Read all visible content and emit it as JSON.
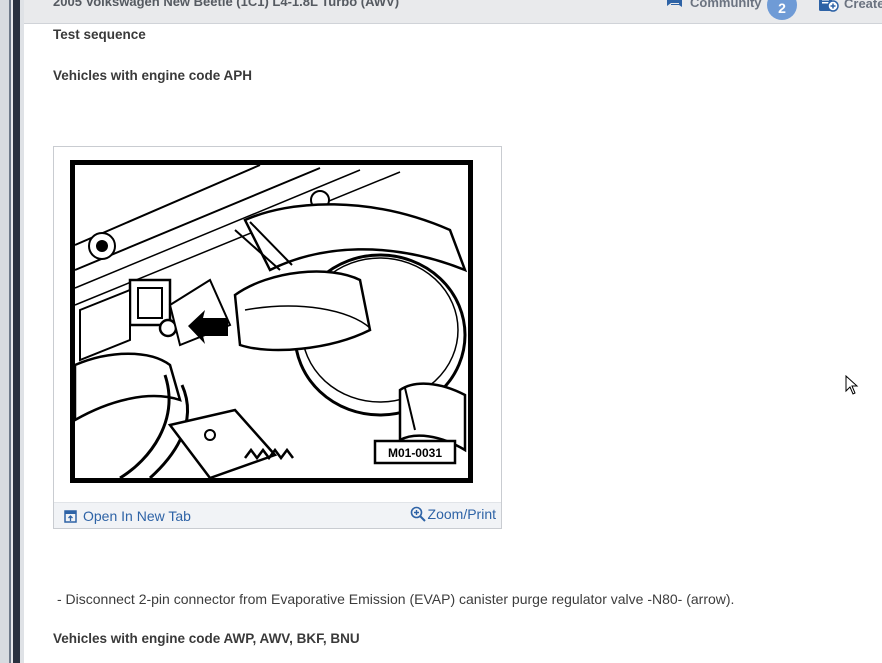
{
  "topbar": {
    "vehicle_title": "2005 Volkswagen New Beetle (1C1) L4-1.8L Turbo (AWV)",
    "community_label": "Community",
    "community_count": "2",
    "create_label": "Create"
  },
  "content": {
    "test_sequence": "Test sequence",
    "heading_aph": "Vehicles with engine code APH",
    "figure": {
      "image_label": "M01-0031",
      "open_tab_label": "Open In New Tab",
      "zoom_label": "Zoom/Print"
    },
    "step_text": "-  Disconnect 2-pin connector from Evaporative Emission (EVAP) canister purge regulator valve -N80- (arrow).",
    "heading_awp": "Vehicles with engine code AWP, AWV, BKF, BNU"
  },
  "icons": {
    "community": "chat-bubbles-icon",
    "create": "create-document-icon",
    "open_tab": "open-new-tab-icon",
    "zoom": "zoom-in-icon",
    "cursor": "mouse-pointer-icon"
  },
  "colors": {
    "link": "#2e63a6",
    "badge": "#6f9bd6",
    "topbar": "#e9eaec"
  }
}
